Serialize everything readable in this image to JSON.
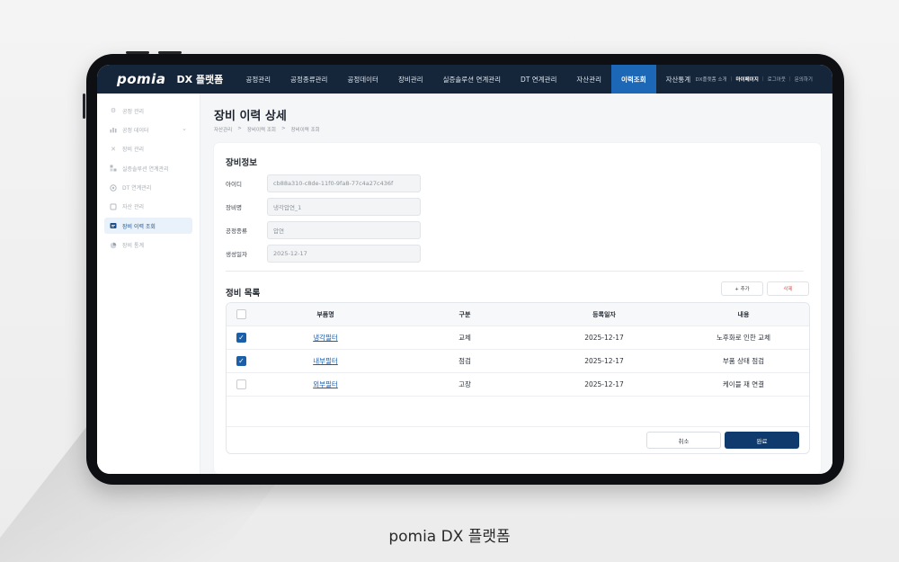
{
  "app": {
    "logo": "pomia",
    "brand": "DX 플랫폼",
    "caption": "pomia DX 플랫폼"
  },
  "topnav": {
    "items": [
      {
        "label": "공정관리"
      },
      {
        "label": "공정종류관리"
      },
      {
        "label": "공정데이터"
      },
      {
        "label": "장비관리"
      },
      {
        "label": "실증솔루션 연계관리"
      },
      {
        "label": "DT 연계관리"
      },
      {
        "label": "자산관리"
      },
      {
        "label": "이력조회",
        "active": true
      },
      {
        "label": "자산통계"
      }
    ],
    "util": {
      "intro": "DX플랫폼 소개",
      "mypage": "마이페이지",
      "logout": "로그아웃",
      "inquiry": "문의하기"
    }
  },
  "sidebar": {
    "items": [
      {
        "label": "공정 관리",
        "icon": "gear-icon"
      },
      {
        "label": "공정 데이터",
        "icon": "chart-icon",
        "expandable": true
      },
      {
        "label": "장비 관리",
        "icon": "tools-icon"
      },
      {
        "label": "실증솔루션 연계관리",
        "icon": "puzzle-icon"
      },
      {
        "label": "DT 연계관리",
        "icon": "dt-icon"
      },
      {
        "label": "자산 관리",
        "icon": "asset-icon"
      },
      {
        "label": "장비 이력 조회",
        "icon": "history-icon",
        "active": true
      },
      {
        "label": "장비 통계",
        "icon": "pie-chart-icon"
      }
    ]
  },
  "page": {
    "title": "장비 이력 상세",
    "breadcrumb": [
      "자산관리",
      "장비이력 조회",
      "장비이력 조회"
    ]
  },
  "equipment_info": {
    "title": "장비정보",
    "fields": [
      {
        "label": "아이디",
        "value": "cb88a310-c8de-11f0-9fa8-77c4a27c436f"
      },
      {
        "label": "장비명",
        "value": "냉각압연_1"
      },
      {
        "label": "공정종류",
        "value": "압연"
      },
      {
        "label": "생성일자",
        "value": "2025-12-17"
      }
    ]
  },
  "maintenance": {
    "title": "정비 목록",
    "add_label": "+ 추가",
    "delete_label": "삭제",
    "columns": [
      "부품명",
      "구분",
      "등록일자",
      "내용"
    ],
    "rows": [
      {
        "part": "냉각필터",
        "type": "교체",
        "date": "2025-12-17",
        "note": "노후화로 인한 교체",
        "checked": true
      },
      {
        "part": "내부필터",
        "type": "점검",
        "date": "2025-12-17",
        "note": "부품 상태 점검",
        "checked": true
      },
      {
        "part": "외부필터",
        "type": "고장",
        "date": "2025-12-17",
        "note": "케이블 재 연결",
        "checked": false
      }
    ],
    "cancel_label": "취소",
    "confirm_label": "완료"
  },
  "colors": {
    "topbar": "#16263a",
    "accent": "#1c67b6",
    "primary_button": "#0f3a6e",
    "delete": "#d9534f"
  }
}
